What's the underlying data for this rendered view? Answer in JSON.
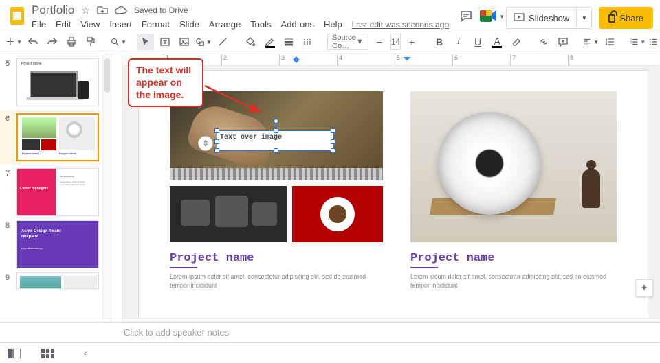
{
  "header": {
    "doc_title": "Portfolio",
    "saved_text": "Saved to Drive",
    "slideshow_label": "Slideshow",
    "share_label": "Share"
  },
  "menubar": {
    "file": "File",
    "edit": "Edit",
    "view": "View",
    "insert": "Insert",
    "format": "Format",
    "slide": "Slide",
    "arrange": "Arrange",
    "tools": "Tools",
    "addons": "Add-ons",
    "help": "Help",
    "last_edit": "Last edit was seconds ago"
  },
  "toolbar": {
    "font_name": "Source Co…",
    "font_size": "14",
    "bold": "B",
    "italic": "I",
    "underline": "U",
    "text_color_letter": "A",
    "more": "•••"
  },
  "ruler": {
    "ticks": [
      "1",
      "2",
      "3",
      "4",
      "5",
      "6",
      "7",
      "8"
    ]
  },
  "callout": "The text will appear on the image.",
  "textbox": {
    "content": "Text over image"
  },
  "slide": {
    "left": {
      "title": "Project name",
      "desc": "Lorem ipsum dolor sit amet, consectetur adipiscing elit, sed do eiusmod tempor incididunt"
    },
    "right": {
      "title": "Project name",
      "desc": "Lorem ipsum dolor sit amet, consectetur adipiscing elit, sed do eiusmod tempor incididunt"
    }
  },
  "thumbs": {
    "n5": "5",
    "n6": "6",
    "n7": "7",
    "n8": "8",
    "n9": "9",
    "t5_title": "Project name",
    "t6_p1": "Project name",
    "t6_p2": "Project name",
    "t7_left": "Career highlights",
    "t7_right_h": "xx xxxxxxxx",
    "t7_right_b": "Lorem ipsum dolor sit amet consectetur adip elit sed do",
    "t8_title": "Acme Design Award recipient",
    "t8_sub": "Parker Meets campaign"
  },
  "notes": {
    "placeholder": "Click to add speaker notes"
  }
}
